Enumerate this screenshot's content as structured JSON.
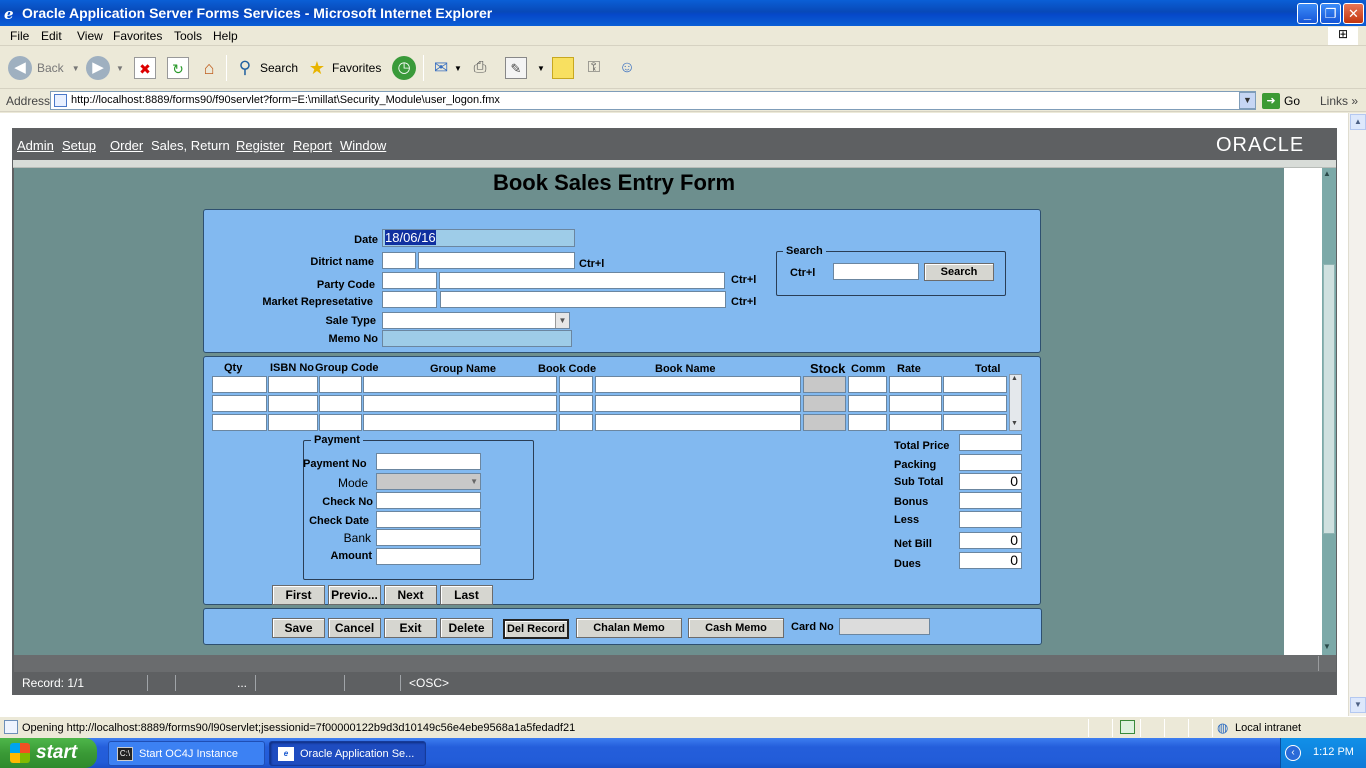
{
  "window": {
    "title": "Oracle Application Server Forms Services - Microsoft Internet Explorer",
    "minimize": "_",
    "maximize": "❐",
    "close": "✕"
  },
  "ie_menu": [
    "File",
    "Edit",
    "View",
    "Favorites",
    "Tools",
    "Help"
  ],
  "toolbar": {
    "back": "Back",
    "search": "Search",
    "favorites": "Favorites"
  },
  "address": {
    "label": "Address",
    "url": "http://localhost:8889/forms90/f90servlet?form=E:\\millat\\Security_Module\\user_logon.fmx",
    "go": "Go",
    "links": "Links"
  },
  "oracle_menu": [
    "Admin",
    "Setup",
    "Order",
    "Sales, Return",
    "Register",
    "Report",
    "Window"
  ],
  "oracle_logo": "ORACLE",
  "form": {
    "title": "Book Sales Entry Form",
    "date_label": "Date",
    "date_value": "18/06/16",
    "district_label": "Ditrict name",
    "party_label": "Party Code",
    "market_label": "Market Represetative",
    "sale_type_label": "Sale Type",
    "memo_label": "Memo No",
    "ctrl_hint": "Ctr+l",
    "search_group": "Search",
    "search_ctrl": "Ctr+l",
    "search_button": "Search"
  },
  "grid": {
    "headers": [
      "Qty",
      "ISBN No",
      "Group Code",
      "Group Name",
      "Book Code",
      "Book Name",
      "Stock",
      "Comm",
      "Rate",
      "Total"
    ]
  },
  "payment": {
    "group": "Payment",
    "payment_no": "Payment No",
    "mode": "Mode",
    "check_no": "Check No",
    "check_date": "Check Date",
    "bank": "Bank",
    "amount": "Amount"
  },
  "totals": {
    "total_price": "Total Price",
    "packing": "Packing",
    "sub_total": "Sub Total",
    "sub_total_value": "0",
    "bonus": "Bonus",
    "less": "Less",
    "net_bill": "Net Bill",
    "net_bill_value": "0",
    "dues": "Dues",
    "dues_value": "0"
  },
  "nav": {
    "first": "First",
    "previous": "Previo...",
    "next": "Next",
    "last": "Last"
  },
  "actions": {
    "save": "Save",
    "cancel": "Cancel",
    "exit": "Exit",
    "delete": "Delete",
    "del_record": "Del Record",
    "chalan_memo": "Chalan Memo",
    "cash_memo": "Cash Memo",
    "card_no": "Card No"
  },
  "record_bar": {
    "record": "Record: 1/1",
    "dots": "...",
    "osc": "<OSC>"
  },
  "ie_status": {
    "text": "Opening http://localhost:8889/forms90/l90servlet;jsessionid=7f00000122b9d3d10149c56e4ebe9568a1a5fedadf21",
    "zone": "Local intranet"
  },
  "taskbar": {
    "start": "start",
    "task1": "Start OC4J Instance",
    "task2": "Oracle Application Se...",
    "clock": "1:12 PM"
  }
}
